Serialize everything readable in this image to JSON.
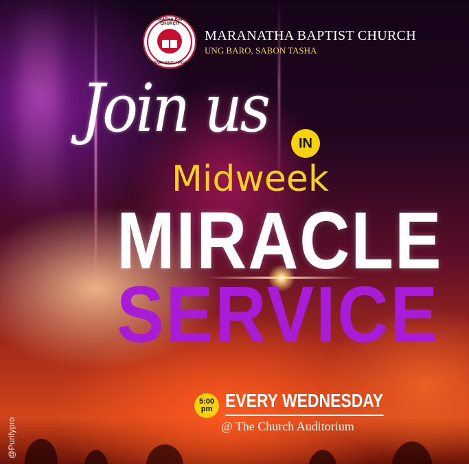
{
  "church": {
    "name": "MARANATHA BAPTIST CHURCH",
    "location": "UNG BARO, SABON TASHA",
    "logo_top_text": "MARANATHA BAPTIST CHURCH",
    "logo_bottom_text": "UNGWAN BARO, KADUNA"
  },
  "headline": {
    "join_us": "Join us",
    "in": "IN",
    "midweek": "Midweek",
    "miracle": "MIRACLE",
    "service": "SERVICE"
  },
  "schedule": {
    "time": "5:00",
    "period": "pm",
    "day": "EVERY WEDNESDAY",
    "venue": "@ The Church Auditorium"
  },
  "credit": "@Purifypro",
  "colors": {
    "accent_yellow": "#f5d20c",
    "service_purple": "#a71bd9",
    "logo_red": "#c8102e"
  }
}
